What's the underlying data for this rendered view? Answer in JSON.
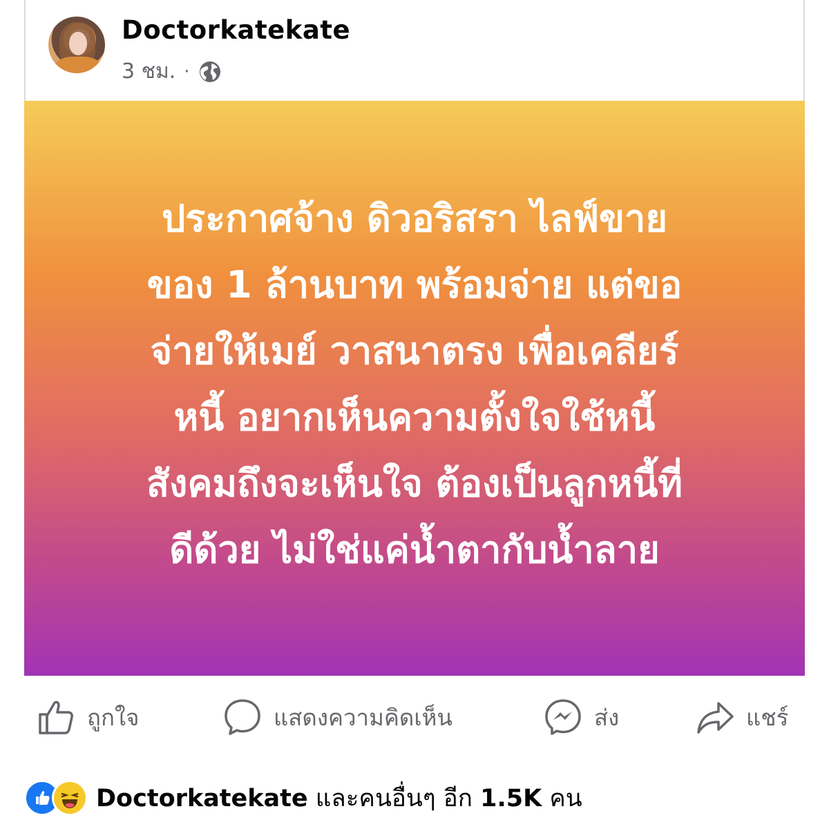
{
  "post": {
    "author": "Doctorkatekate",
    "time": "3 ชม.",
    "separator": "·",
    "privacy_icon": "globe-icon",
    "background_colors": [
      "#f5cb58",
      "#f0913e",
      "#e06b64",
      "#c24a8c",
      "#a233b4"
    ],
    "text_lines": [
      "ประกาศจ้าง ดิวอริสรา ไลฟ์ขาย",
      "ของ 1 ล้านบาท พร้อมจ่าย แต่ขอ",
      "จ่ายให้เมย์ วาสนาตรง เพื่อเคลียร์",
      "หนี้ อยากเห็นความตั้งใจใช้หนี้",
      "สังคมถึงจะเห็นใจ ต้องเป็นลูกหนี้ที่",
      "ดีด้วย ไม่ใช่แค่น้ำตากับน้ำลาย"
    ]
  },
  "actions": {
    "like": {
      "label": "ถูกใจ",
      "icon": "thumbs-up-icon"
    },
    "comment": {
      "label": "แสดงความคิดเห็น",
      "icon": "comment-bubble-icon"
    },
    "send": {
      "label": "ส่ง",
      "icon": "messenger-icon"
    },
    "share": {
      "label": "แชร์",
      "icon": "share-arrow-icon"
    }
  },
  "reactions": {
    "icons": [
      "like-reaction-icon",
      "haha-reaction-icon"
    ],
    "name": "Doctorkatekate",
    "middle": " และคนอื่นๆ อีก ",
    "count": "1.5K",
    "suffix": " คน"
  }
}
